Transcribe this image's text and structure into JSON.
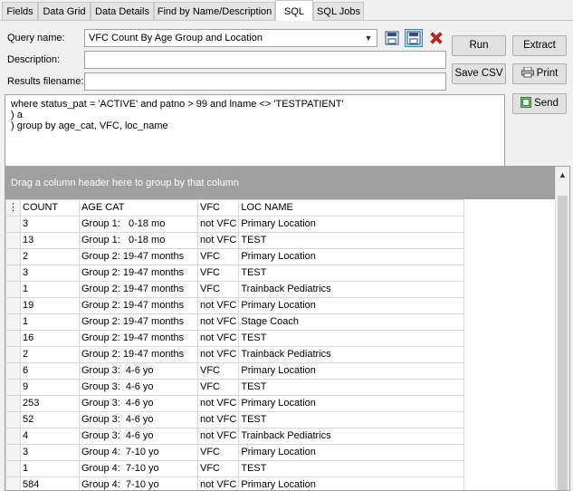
{
  "tabs": [
    {
      "label": "Fields",
      "active": false
    },
    {
      "label": "Data Grid",
      "active": false
    },
    {
      "label": "Data Details",
      "active": false
    },
    {
      "label": "Find by Name/Description",
      "active": false
    },
    {
      "label": "SQL",
      "active": true
    },
    {
      "label": "SQL Jobs",
      "active": false
    }
  ],
  "form": {
    "query_name_label": "Query name:",
    "query_name_value": "VFC Count By Age Group and Location",
    "description_label": "Description:",
    "description_value": "",
    "results_label": "Results filename:",
    "results_value": ""
  },
  "buttons": {
    "run": "Run",
    "extract": "Extract",
    "save_csv": "Save CSV",
    "print": "Print",
    "send": "Send"
  },
  "sql_text": "where status_pat = 'ACTIVE' and patno > 99 and lname <> 'TESTPATIENT'\n) a\n) group by age_cat, VFC, loc_name",
  "grid": {
    "group_hint": "Drag a column header here to group by that column",
    "columns": [
      "COUNT",
      "AGE CAT",
      "VFC",
      "LOC NAME"
    ],
    "rows": [
      [
        "3",
        "Group 1:   0-18 mo",
        "not VFC",
        "Primary Location"
      ],
      [
        "13",
        "Group 1:   0-18 mo",
        "not VFC",
        "TEST"
      ],
      [
        "2",
        "Group 2: 19-47 months",
        "VFC",
        "Primary Location"
      ],
      [
        "3",
        "Group 2: 19-47 months",
        "VFC",
        "TEST"
      ],
      [
        "1",
        "Group 2: 19-47 months",
        "VFC",
        "Trainback Pediatrics"
      ],
      [
        "19",
        "Group 2: 19-47 months",
        "not VFC",
        "Primary Location"
      ],
      [
        "1",
        "Group 2: 19-47 months",
        "not VFC",
        "Stage Coach"
      ],
      [
        "16",
        "Group 2: 19-47 months",
        "not VFC",
        "TEST"
      ],
      [
        "2",
        "Group 2: 19-47 months",
        "not VFC",
        "Trainback Pediatrics"
      ],
      [
        "6",
        "Group 3:  4-6 yo",
        "VFC",
        "Primary Location"
      ],
      [
        "9",
        "Group 3:  4-6 yo",
        "VFC",
        "TEST"
      ],
      [
        "253",
        "Group 3:  4-6 yo",
        "not VFC",
        "Primary Location"
      ],
      [
        "52",
        "Group 3:  4-6 yo",
        "not VFC",
        "TEST"
      ],
      [
        "4",
        "Group 3:  4-6 yo",
        "not VFC",
        "Trainback Pediatrics"
      ],
      [
        "3",
        "Group 4:  7-10 yo",
        "VFC",
        "Primary Location"
      ],
      [
        "1",
        "Group 4:  7-10 yo",
        "VFC",
        "TEST"
      ],
      [
        "584",
        "Group 4:  7-10 yo",
        "not VFC",
        "Primary Location"
      ]
    ]
  }
}
